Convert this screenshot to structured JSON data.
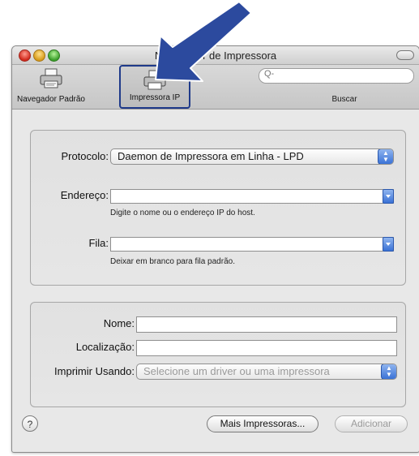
{
  "window": {
    "title": "Navegador de Impressora"
  },
  "toolbar": {
    "items": [
      {
        "label": "Navegador Padrão",
        "icon": "printer-icon"
      },
      {
        "label": "Impressora IP",
        "icon": "network-printer-icon"
      },
      {
        "label": "Buscar",
        "icon": "search-icon"
      }
    ],
    "search": {
      "placeholder": "Q-",
      "value": ""
    }
  },
  "connection": {
    "protocol_label": "Protocolo:",
    "protocol_value": "Daemon de Impressora em Linha - LPD",
    "address_label": "Endereço:",
    "address_value": "",
    "address_hint": "Digite o nome ou o endereço IP do host.",
    "queue_label": "Fila:",
    "queue_value": "",
    "queue_hint": "Deixar em branco para fila padrão."
  },
  "details": {
    "name_label": "Nome:",
    "name_value": "",
    "location_label": "Localização:",
    "location_value": "",
    "print_using_label": "Imprimir Usando:",
    "print_using_value": "Selecione um driver ou uma impressora"
  },
  "footer": {
    "help_label": "?",
    "more_printers_label": "Mais Impressoras...",
    "add_label": "Adicionar"
  },
  "colors": {
    "highlight_border": "#1f3a8a",
    "annotation_arrow": "#2c4a9e",
    "accent_blue": "#3a72d6"
  }
}
